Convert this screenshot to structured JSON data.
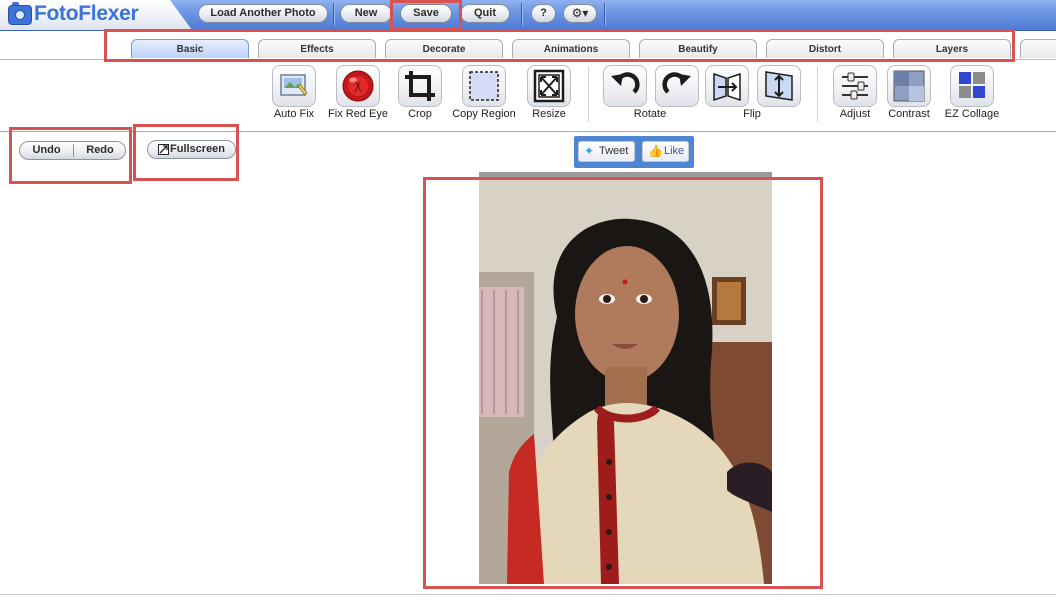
{
  "app": {
    "logo_text": "FotoFlexer",
    "brand_color": "#3d73d6",
    "topbar_buttons": {
      "load": "Load Another Photo",
      "new": "New",
      "save": "Save",
      "quit": "Quit",
      "help": "?",
      "settings_icon": "gear-icon"
    }
  },
  "tabs": [
    {
      "label": "Basic",
      "active": true
    },
    {
      "label": "Effects"
    },
    {
      "label": "Decorate"
    },
    {
      "label": "Animations"
    },
    {
      "label": "Beautify"
    },
    {
      "label": "Distort"
    },
    {
      "label": "Layers"
    }
  ],
  "tools": {
    "auto_fix": "Auto Fix",
    "fix_red_eye": "Fix Red Eye",
    "crop": "Crop",
    "copy_region": "Copy Region",
    "resize": "Resize",
    "rotate": "Rotate",
    "flip": "Flip",
    "adjust": "Adjust",
    "contrast": "Contrast",
    "ez_collage": "EZ Collage"
  },
  "history": {
    "undo": "Undo",
    "redo": "Redo"
  },
  "view": {
    "fullscreen": "Fullscreen"
  },
  "social": {
    "tweet": "Tweet",
    "like": "Like"
  },
  "highlight_color": "#d95252"
}
